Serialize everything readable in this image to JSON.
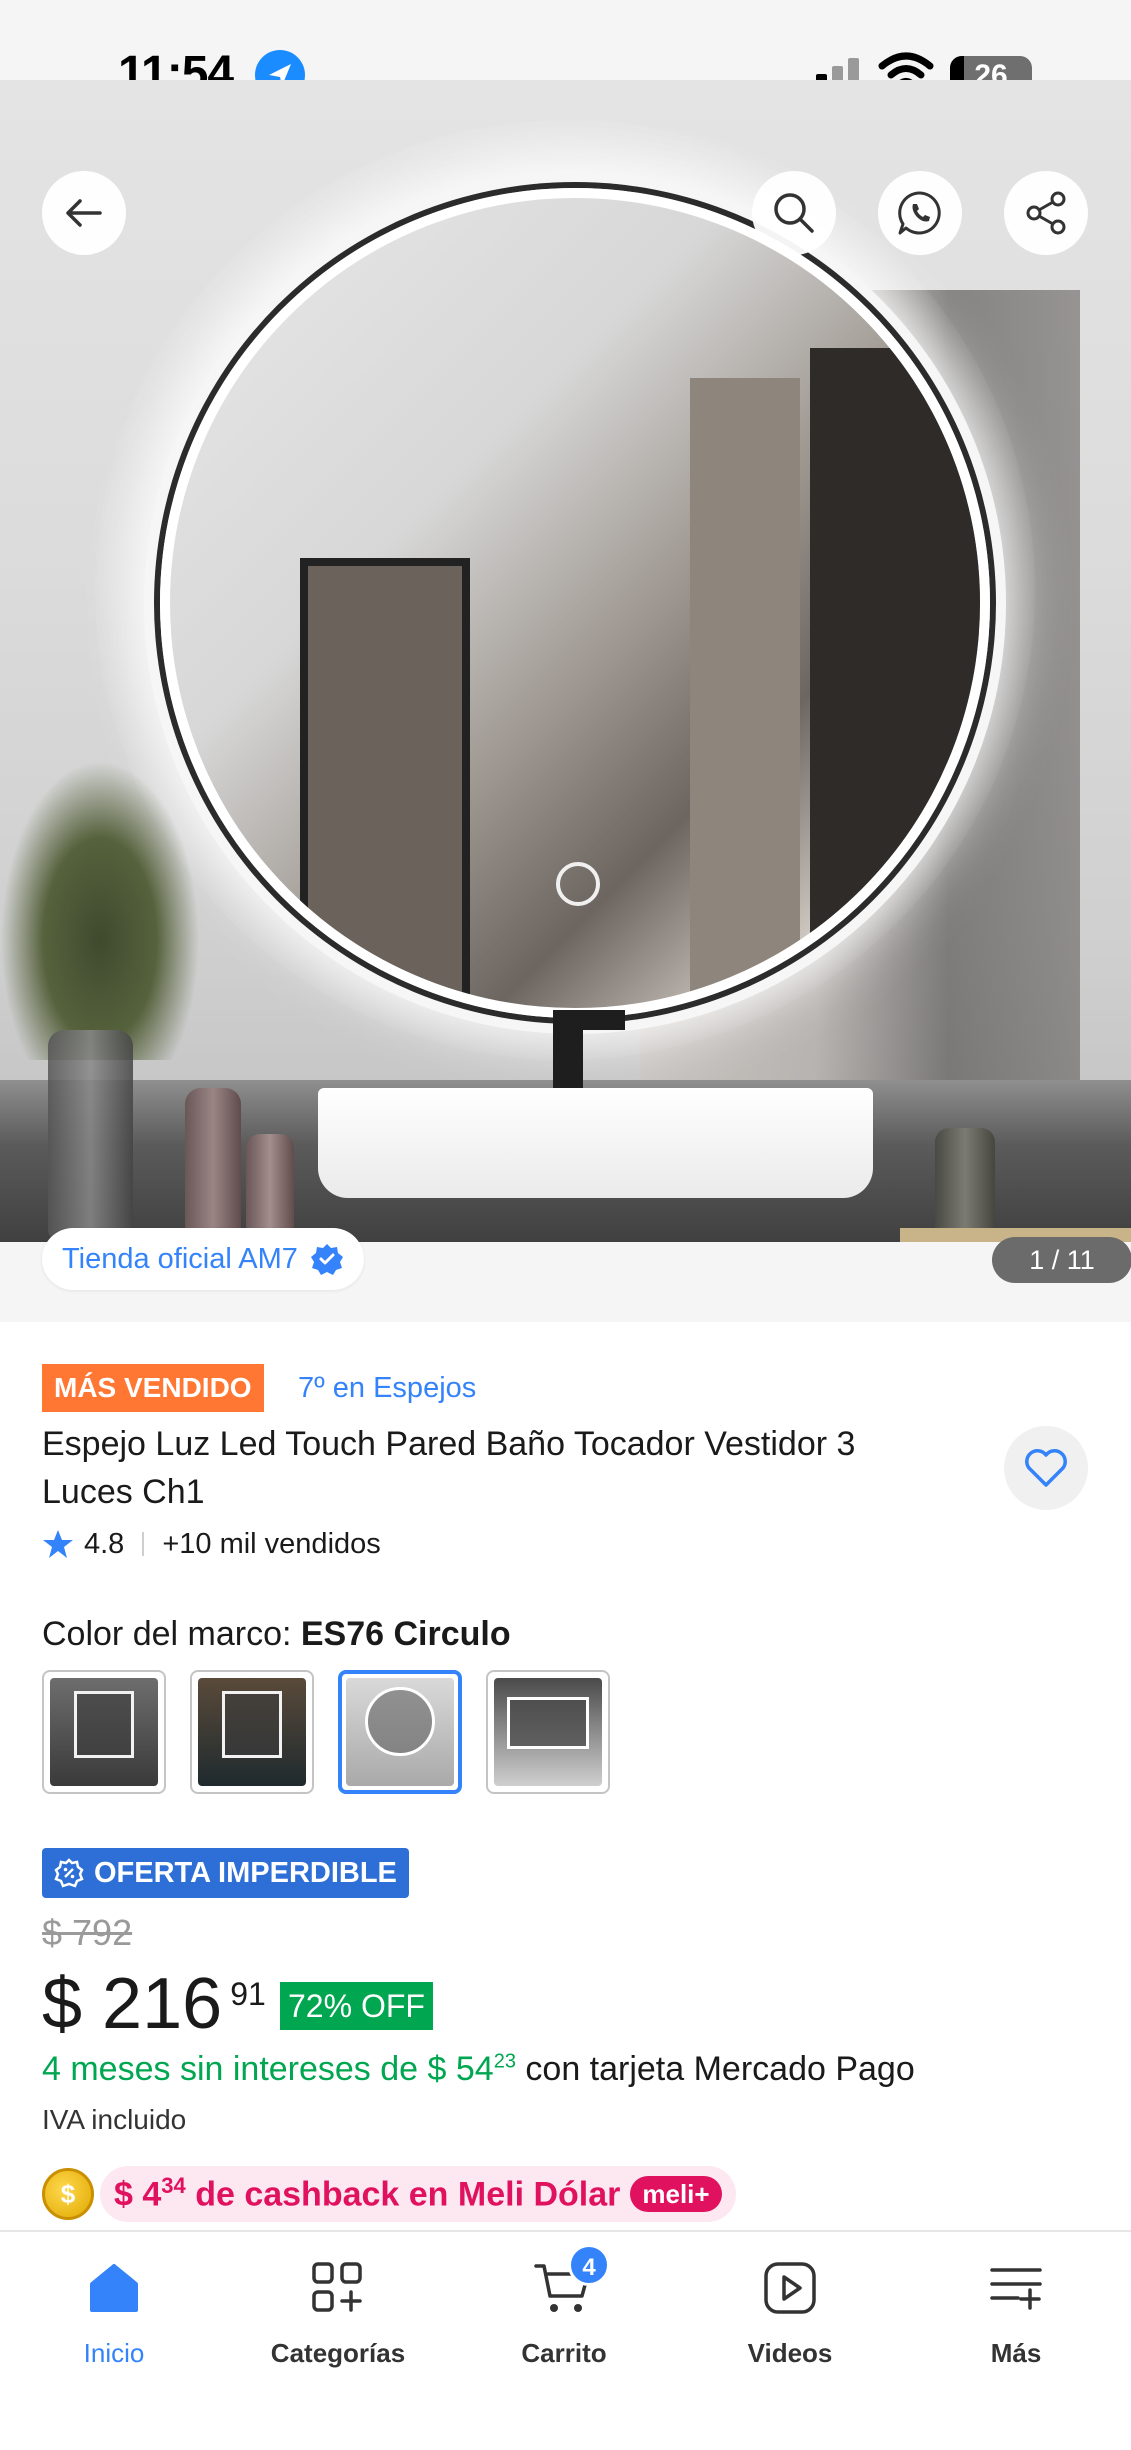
{
  "status_bar": {
    "time": "11:54",
    "battery": "26"
  },
  "gallery": {
    "store_label": "Tienda oficial AM7",
    "image_counter": "1 / 11"
  },
  "product": {
    "badge_best_seller": "MÁS VENDIDO",
    "rank": "7º en Espejos",
    "title": "Espejo Luz Led Touch Pared Baño Tocador Vestidor 3 Luces Ch1",
    "rating": "4.8",
    "sold": "+10 mil vendidos",
    "color_label": "Color del marco:",
    "color_value": "ES76 Circulo",
    "color_options_selected_index": 2
  },
  "pricing": {
    "offer_badge": "OFERTA IMPERDIBLE",
    "old_price": "$ 792",
    "price_main": "$ 216",
    "price_cents": "91",
    "discount": "72% OFF",
    "installments_prefix": "4 meses sin intereses de $ 54",
    "installments_cents": "23",
    "installments_suffix": "con tarjeta Mercado Pago",
    "tax_note": "IVA incluido"
  },
  "cashback": {
    "amount": "$ 4",
    "amount_cents": "34",
    "text": "de cashback en Meli Dólar",
    "badge": "meli+"
  },
  "bottom_nav": {
    "items": [
      {
        "label": "Inicio",
        "icon": "home-icon",
        "active": true
      },
      {
        "label": "Categorías",
        "icon": "categories-icon",
        "active": false
      },
      {
        "label": "Carrito",
        "icon": "cart-icon",
        "active": false
      },
      {
        "label": "Videos",
        "icon": "video-icon",
        "active": false
      },
      {
        "label": "Más",
        "icon": "more-icon",
        "active": false
      }
    ],
    "cart_count": "4"
  },
  "colors": {
    "accent_blue": "#3483fa",
    "best_seller_orange": "#ff7733",
    "discount_green": "#00a650",
    "cashback_pink": "#e0115f"
  }
}
